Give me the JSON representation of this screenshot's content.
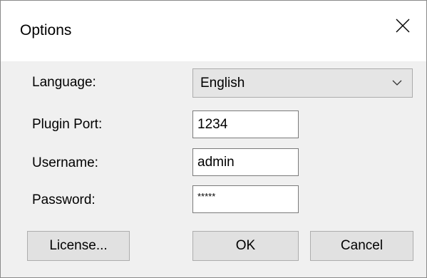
{
  "dialog": {
    "title": "Options",
    "close_icon": "close-icon"
  },
  "fields": {
    "language": {
      "label": "Language:",
      "value": "English"
    },
    "plugin_port": {
      "label": "Plugin Port:",
      "value": "1234"
    },
    "username": {
      "label": "Username:",
      "value": "admin"
    },
    "password": {
      "label": "Password:",
      "value": "*****"
    }
  },
  "buttons": {
    "license": "License...",
    "ok": "OK",
    "cancel": "Cancel"
  }
}
